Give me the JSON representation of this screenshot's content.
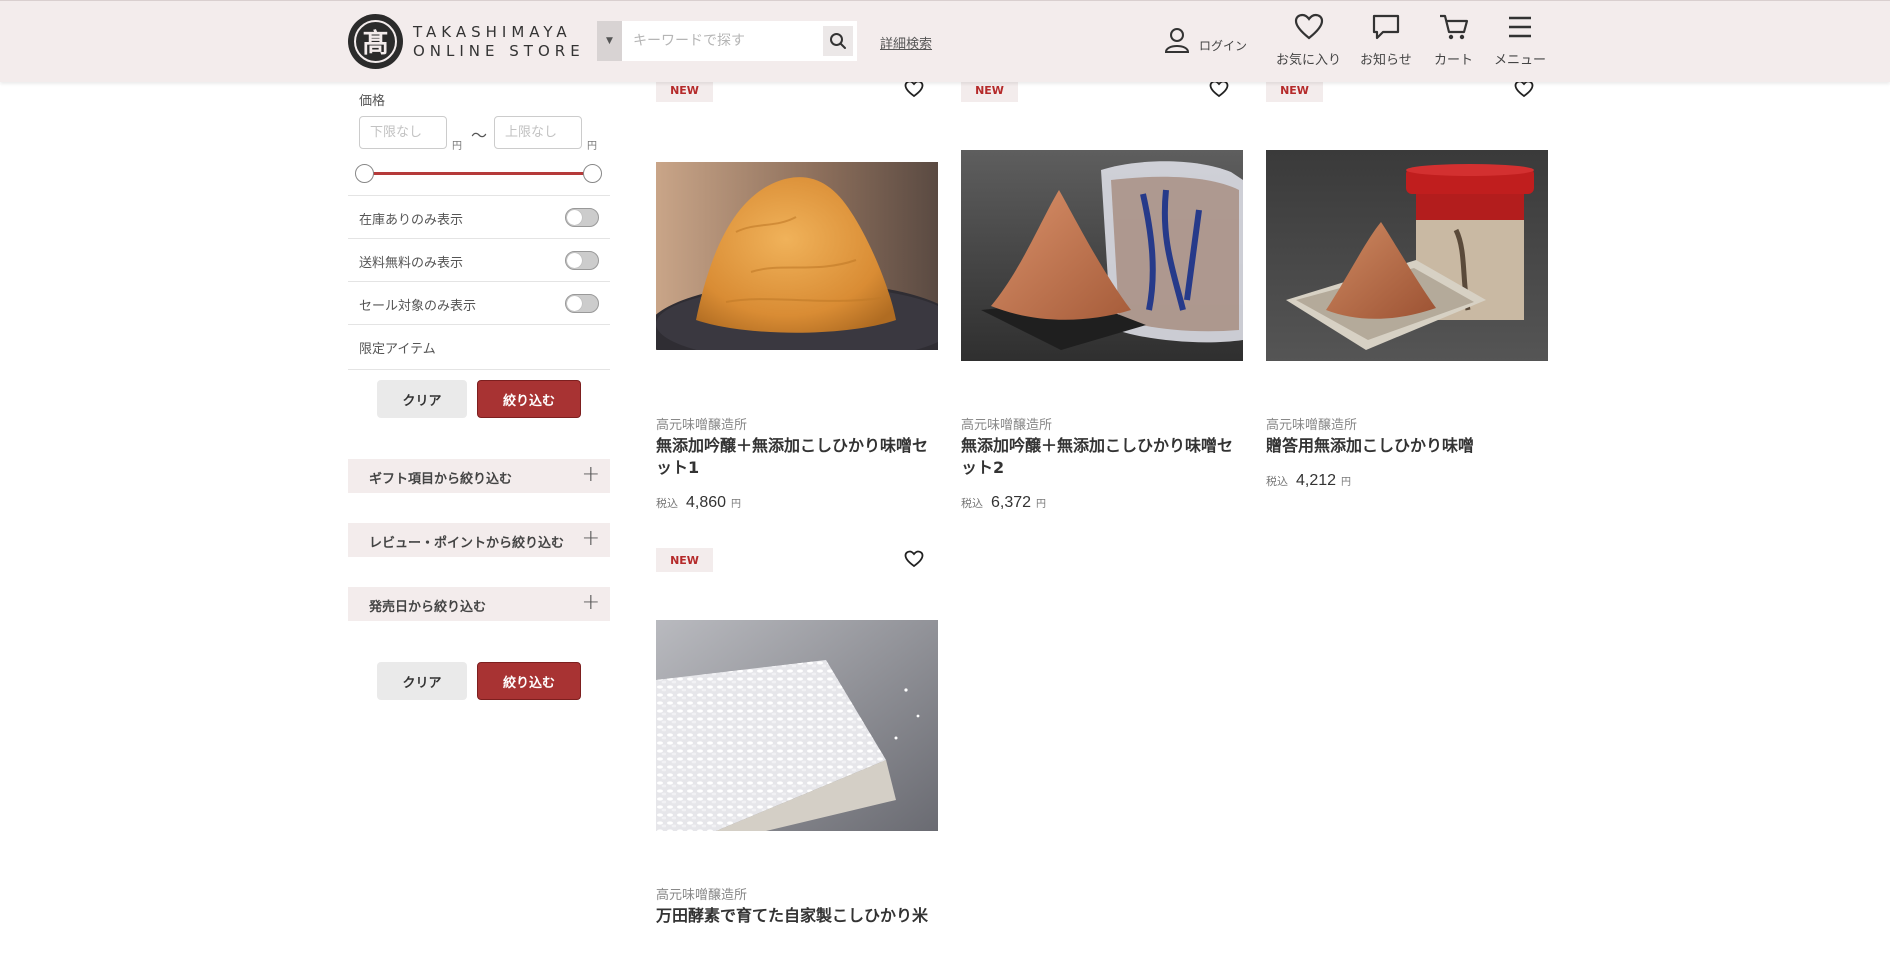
{
  "header": {
    "logo_symbol": "髙",
    "logo_line1": "TAKASHIMAYA",
    "logo_line2": "ONLINE STORE",
    "search_placeholder": "キーワードで探す",
    "advanced_search": "詳細検索",
    "login": "ログイン",
    "favorites": "お気に入り",
    "notifications": "お知らせ",
    "cart": "カート",
    "menu": "メニュー"
  },
  "filters": {
    "price_title": "価格",
    "min_placeholder": "下限なし",
    "max_placeholder": "上限なし",
    "yen": "円",
    "tilde": "〜",
    "price_range": [
      0,
      1
    ],
    "toggles": [
      {
        "label": "在庫ありのみ表示",
        "on": false
      },
      {
        "label": "送料無料のみ表示",
        "on": false
      },
      {
        "label": "セール対象のみ表示",
        "on": false
      }
    ],
    "limited_items": "限定アイテム",
    "clear": "クリア",
    "apply": "絞り込む",
    "accordions": [
      {
        "label": "ギフト項目から絞り込む"
      },
      {
        "label": "レビュー・ポイントから絞り込む"
      },
      {
        "label": "発売日から絞り込む"
      }
    ]
  },
  "products": [
    {
      "badge": "NEW",
      "maker": "高元味噌醸造所",
      "name": "無添加吟醸＋無添加こしひかり味噌セット1",
      "tax": "税込",
      "price": "4,860",
      "unit": "円"
    },
    {
      "badge": "NEW",
      "maker": "高元味噌醸造所",
      "name": "無添加吟醸＋無添加こしひかり味噌セット2",
      "tax": "税込",
      "price": "6,372",
      "unit": "円"
    },
    {
      "badge": "NEW",
      "maker": "高元味噌醸造所",
      "name": "贈答用無添加こしひかり味噌",
      "tax": "税込",
      "price": "4,212",
      "unit": "円"
    },
    {
      "badge": "NEW",
      "maker": "高元味噌醸造所",
      "name": "万田酵素で育てた自家製こしひかり米"
    }
  ],
  "colors": {
    "header_bg": "#f3ecec",
    "accent": "#a83333",
    "badge_text": "#b52a2a"
  }
}
